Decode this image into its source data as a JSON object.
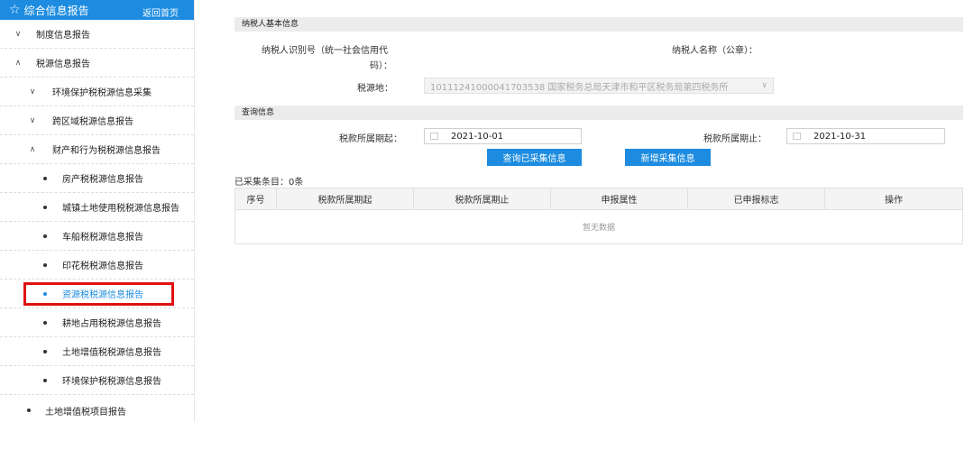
{
  "sidebar": {
    "title": "综合信息报告",
    "back_label": "返回首页",
    "items": [
      {
        "label": "制度信息报告",
        "level": 1,
        "marker": "∨"
      },
      {
        "label": "税源信息报告",
        "level": 1,
        "marker": "∧"
      },
      {
        "label": "环境保护税税源信息采集",
        "level": 2,
        "marker": "∨"
      },
      {
        "label": "跨区域税源信息报告",
        "level": 2,
        "marker": "∨"
      },
      {
        "label": "财产和行为税税源信息报告",
        "level": 2,
        "marker": "∧"
      },
      {
        "label": "房产税税源信息报告",
        "level": 3
      },
      {
        "label": "城镇土地使用税税源信息报告",
        "level": 3
      },
      {
        "label": "车船税税源信息报告",
        "level": 3
      },
      {
        "label": "印花税税源信息报告",
        "level": 3
      },
      {
        "label": "资源税税源信息报告",
        "level": 3,
        "active": true
      },
      {
        "label": "耕地占用税税源信息报告",
        "level": 3
      },
      {
        "label": "土地增值税税源信息报告",
        "level": 3
      },
      {
        "label": "环境保护税税源信息报告",
        "level": 3
      }
    ],
    "last_item": "土地增值税项目报告",
    "accent": "#1d8ce0",
    "highlight_color": "#e01010"
  },
  "basic": {
    "section": "纳税人基本信息",
    "id_label_1": "纳税人识别号（统一社会信用代",
    "id_label_2": "码）：",
    "name_label": "纳税人名称（公章）：",
    "source_label": "税源地：",
    "source_value": "10111241000041703538 国家税务总局天津市和平区税务局第四税务所",
    "source_arrow": "∨"
  },
  "query": {
    "section": "查询信息",
    "start_label": "税款所属期起：",
    "start_value": "2021-10-01",
    "end_label": "税款所属期止：",
    "end_value": "2021-10-31",
    "query_btn": "查询已采集信息",
    "add_btn": "新增采集信息"
  },
  "results": {
    "count_text": "已采集条目：0条",
    "columns": [
      "序号",
      "税款所属期起",
      "税款所属期止",
      "申报属性",
      "已申报标志",
      "操作"
    ],
    "empty_text": "暂无数据"
  }
}
